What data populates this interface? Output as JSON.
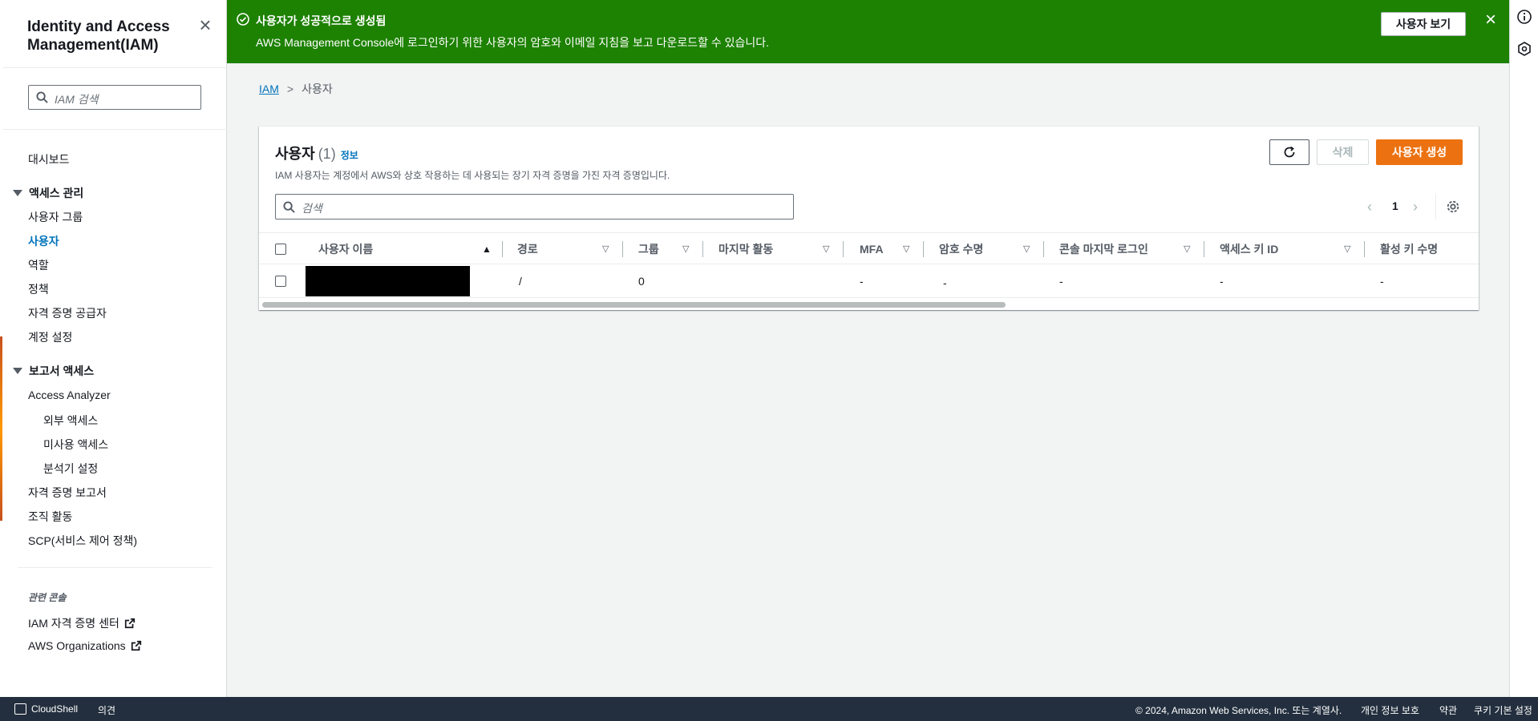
{
  "sidebar": {
    "title": "Identity and Access Management(IAM)",
    "search_placeholder": "IAM 검색",
    "dashboard": "대시보드",
    "access_management": {
      "label": "액세스 관리",
      "items": [
        "사용자 그룹",
        "사용자",
        "역할",
        "정책",
        "자격 증명 공급자",
        "계정 설정"
      ],
      "active_item": "사용자"
    },
    "access_reports": {
      "label": "보고서 액세스",
      "items": {
        "access_analyzer": "Access Analyzer",
        "external_access": "외부 액세스",
        "unused_access": "미사용 액세스",
        "analyzer_settings": "분석기 설정",
        "credential_report": "자격 증명 보고서",
        "org_activity": "조직 활동",
        "scp": "SCP(서비스 제어 정책)"
      }
    },
    "related_consoles": {
      "label": "관련 콘솔",
      "items": [
        "IAM 자격 증명 센터",
        "AWS Organizations"
      ]
    }
  },
  "banner": {
    "title": "사용자가 성공적으로 생성됨",
    "description": "AWS Management Console에 로그인하기 위한 사용자의 암호와 이메일 지침을 보고 다운로드할 수 있습니다.",
    "view_button": "사용자 보기",
    "color": "#1d8102"
  },
  "breadcrumb": {
    "root": "IAM",
    "current": "사용자"
  },
  "users_panel": {
    "title": "사용자",
    "count": "(1)",
    "info_link": "정보",
    "description": "IAM 사용자는 계정에서 AWS와 상호 작용하는 데 사용되는 장기 자격 증명을 가진 자격 증명입니다.",
    "delete_button": "삭제",
    "create_button": "사용자 생성",
    "search_placeholder": "검색",
    "page": "1",
    "columns": [
      "사용자 이름",
      "경로",
      "그룹",
      "마지막 활동",
      "MFA",
      "암호 수명",
      "콘솔 마지막 로그인",
      "액세스 키 ID",
      "활성 키 수명"
    ],
    "rows": [
      {
        "user_name": "",
        "path": "/",
        "groups": "0",
        "last_activity": "",
        "mfa": "-",
        "password_age": "-",
        "console_last_signin": "-",
        "access_key_id": "-",
        "active_key_age": "-"
      }
    ]
  },
  "footer": {
    "cloudshell": "CloudShell",
    "feedback": "의견",
    "copyright": "© 2024, Amazon Web Services, Inc. 또는 계열사.",
    "privacy": "개인 정보 보호",
    "terms": "약관",
    "cookie_prefs": "쿠키 기본 설정"
  },
  "colors": {
    "accent_orange": "#ec7211",
    "link_blue": "#0073bb",
    "footer_bg": "#232f3e"
  }
}
